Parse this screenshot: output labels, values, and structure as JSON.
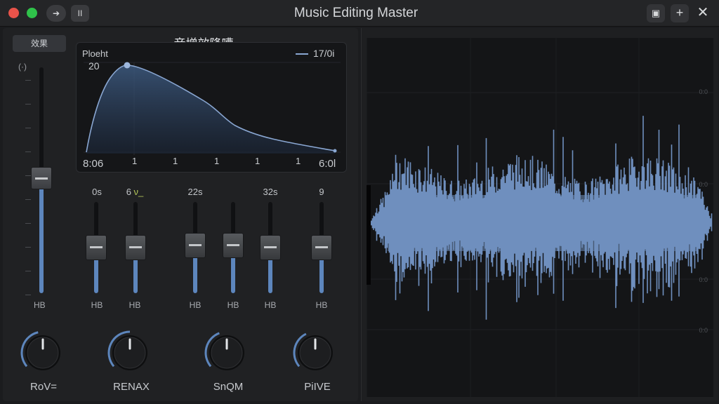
{
  "titlebar": {
    "title": "Music Editing Master",
    "back_icon": "➔",
    "pause_icon": "II",
    "save_icon": "▣",
    "add_icon": "+",
    "close_icon": "✕"
  },
  "left": {
    "preset_label": "效果",
    "panel_title": "音增效降嘈",
    "master": {
      "label": "(·)",
      "level_pct": 50,
      "out_label": "HB"
    },
    "eq": {
      "label": "Ploeht",
      "peak_value": "20",
      "legend": "17/0i",
      "x_start": "8:06",
      "x_end": "6:0l",
      "x_ticks": [
        "1",
        "1",
        "1",
        "1",
        "1"
      ]
    },
    "channels": [
      {
        "value": "0ѕ",
        "accent": "",
        "level_pct": 50,
        "foot": "HB"
      },
      {
        "value": "6 ",
        "accent": "ν_",
        "level_pct": 50,
        "foot": "HB"
      },
      {
        "value": "22ѕ",
        "accent": "",
        "level_pct": 52,
        "foot": "HB"
      },
      {
        "value": "",
        "accent": "",
        "level_pct": 52,
        "foot": "HB"
      },
      {
        "value": "32ѕ",
        "accent": "",
        "level_pct": 50,
        "foot": "HB"
      },
      {
        "value": "9",
        "accent": "",
        "level_pct": 50,
        "foot": "HB"
      }
    ],
    "knobs": [
      {
        "label": "RoV=",
        "value_pct": 45
      },
      {
        "label": "RENAX",
        "value_pct": 50
      },
      {
        "label": "SnQM",
        "value_pct": 42
      },
      {
        "label": "PiIVE",
        "value_pct": 40
      }
    ]
  },
  "waveform": {
    "db_labels": [
      "0:0",
      "0:0",
      "0:0",
      "0:0"
    ],
    "wave_color": "#6f8fbe"
  },
  "colors": {
    "accent": "#5d86bd",
    "background": "#1b1c1e"
  }
}
